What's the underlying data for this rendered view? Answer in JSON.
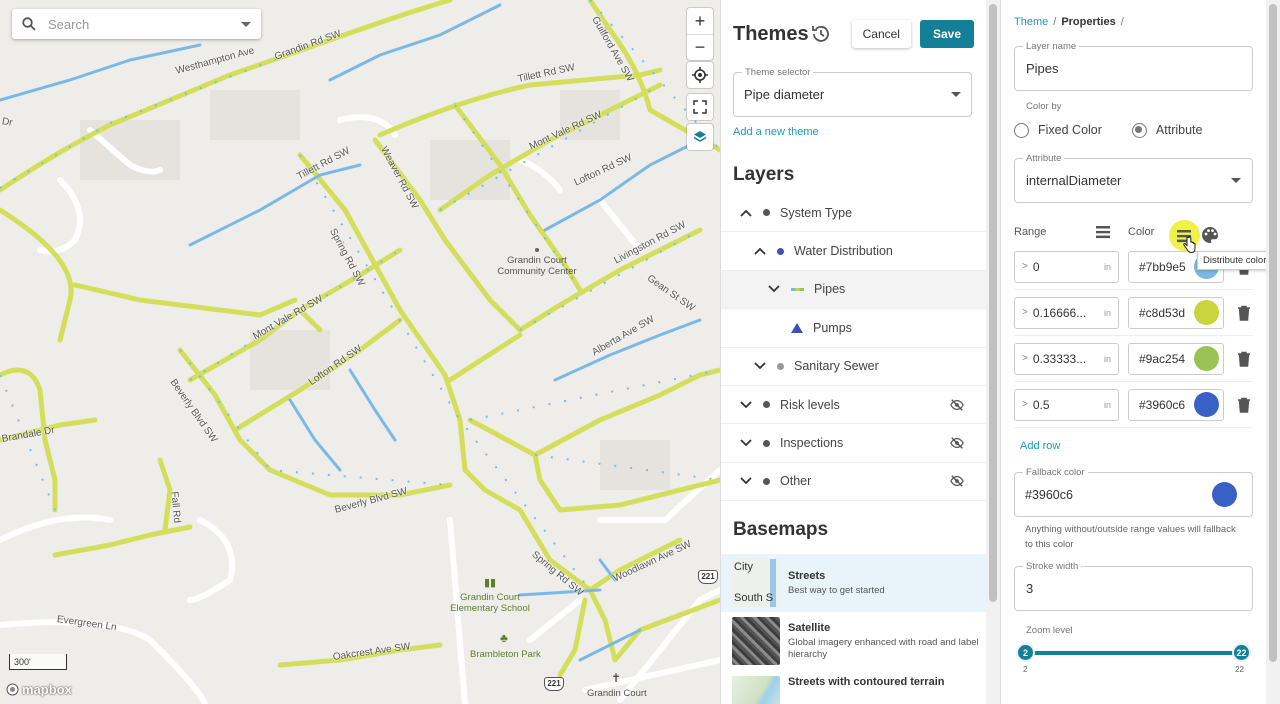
{
  "map": {
    "search_placeholder": "Search",
    "streets": [
      "Westhampton Ave",
      "Grandin Rd SW",
      "Guilford Ave SW",
      "Tillett Rd SW",
      "Mont Vale Rd SW",
      "Weaver Rd SW",
      "Lofton Rd SW",
      "Tillett Rd SW",
      "Spring Rd SW",
      "Livingston Rd SW",
      "Gean St SW",
      "Mont Vale Rd SW",
      "Lofton Rd SW",
      "Alberta Ave SW",
      "Beverly Blvd SW",
      "Beverly Blvd SW",
      "Fall Rd",
      "Spring Rd SW",
      "Woodlawn Ave SW",
      "Evergreen Ln",
      "Oakcrest Ave SW",
      "Brandale Dr",
      "Dr"
    ],
    "pois": {
      "community_center": "Grandin Court\nCommunity Center",
      "school": "Grandin Court\nElementary School",
      "park": "Brambleton Park",
      "church": "Grandin Court"
    },
    "shields": [
      "221",
      "221"
    ],
    "scale": "300'",
    "attribution": "mapbox",
    "controls": {
      "zoom_in": "+",
      "zoom_out": "−"
    }
  },
  "themes_panel": {
    "title": "Themes",
    "cancel_label": "Cancel",
    "save_label": "Save",
    "theme_selector": {
      "label": "Theme selector",
      "value": "Pipe diameter"
    },
    "add_theme": "Add a new theme",
    "layers_title": "Layers",
    "layers": [
      {
        "label": "System Type",
        "expand": "up",
        "dot": "#555555",
        "indent": 0,
        "hidden": false
      },
      {
        "label": "Water Distribution",
        "expand": "up",
        "dot": "#3f51b5",
        "indent": 1,
        "hidden": false
      },
      {
        "label": "Pipes",
        "expand": "down",
        "dot": "line",
        "indent": 2,
        "hidden": false,
        "active": true
      },
      {
        "label": "Pumps",
        "expand": "none",
        "dot": "triangle",
        "indent": 2,
        "hidden": false
      },
      {
        "label": "Sanitary Sewer",
        "expand": "down",
        "dot": "#999999",
        "indent": 1,
        "hidden": false
      },
      {
        "label": "Risk levels",
        "expand": "down",
        "dot": "#555555",
        "indent": 0,
        "hidden": true
      },
      {
        "label": "Inspections",
        "expand": "down",
        "dot": "#555555",
        "indent": 0,
        "hidden": true
      },
      {
        "label": "Other",
        "expand": "down",
        "dot": "#555555",
        "indent": 0,
        "hidden": true
      }
    ],
    "basemaps_title": "Basemaps",
    "basemaps": [
      {
        "name": "Streets",
        "desc": "Best way to get started",
        "thumb_a": "City",
        "thumb_b": "South S"
      },
      {
        "name": "Satellite",
        "desc": "Global imagery enhanced with road and label hierarchy"
      },
      {
        "name": "Streets with contoured terrain",
        "desc": ""
      }
    ]
  },
  "properties_panel": {
    "breadcrumb": {
      "root": "Theme",
      "current": "Properties"
    },
    "layer_name": {
      "label": "Layer name",
      "value": "Pipes"
    },
    "color_by": {
      "label": "Color by",
      "options": [
        "Fixed Color",
        "Attribute"
      ],
      "selected": "Attribute"
    },
    "attribute": {
      "label": "Attribute",
      "value": "internalDiameter"
    },
    "range_header": "Range",
    "color_header": "Color",
    "tooltip": "Distribute colors",
    "ranges": [
      {
        "op": ">",
        "value": "0",
        "unit": "in",
        "color": "#7bb9e5"
      },
      {
        "op": ">",
        "value": "0.16666...",
        "unit": "in",
        "color": "#c8d53d"
      },
      {
        "op": ">",
        "value": "0.33333...",
        "unit": "in",
        "color": "#9ac254"
      },
      {
        "op": ">",
        "value": "0.5",
        "unit": "in",
        "color": "#3960c6"
      }
    ],
    "add_row": "Add row",
    "fallback": {
      "label": "Fallback color",
      "value": "#3960c6",
      "hint": "Anything without/outside range values will fallback to this color"
    },
    "stroke": {
      "label": "Stroke width",
      "value": "3"
    },
    "zoom": {
      "label": "Zoom level",
      "min": "2",
      "max": "22",
      "tick_min": "2",
      "tick_max": "22"
    }
  }
}
